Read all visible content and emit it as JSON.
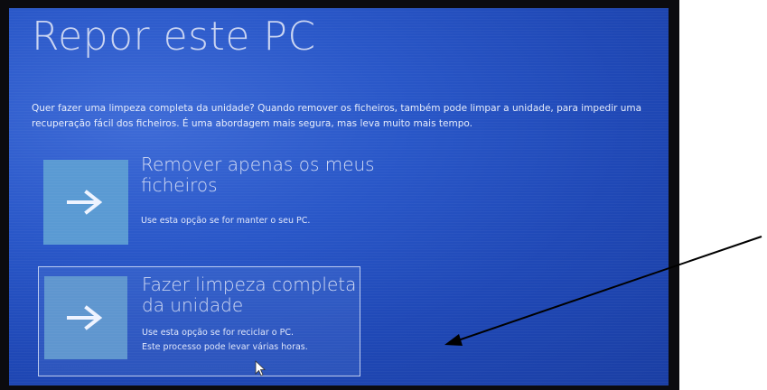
{
  "screen": {
    "title": "Repor este PC",
    "description": "Quer fazer uma limpeza completa da unidade? Quando remover os ficheiros, também pode limpar a unidade, para impedir uma recuperação fácil dos ficheiros. É uma abordagem mais segura, mas leva muito mais tempo.",
    "options": [
      {
        "title": "Remover apenas os meus ficheiros",
        "description_lines": [
          "Use esta opção se for manter o seu PC."
        ],
        "icon": "right-arrow-icon",
        "selected": false
      },
      {
        "title": "Fazer limpeza completa da unidade",
        "description_lines": [
          "Use esta opção se for reciclar o PC.",
          "Este processo pode levar várias horas."
        ],
        "icon": "right-arrow-icon",
        "selected": true
      }
    ]
  },
  "colors": {
    "screen_blue": "#2957c8",
    "tile_blue": "#5a9ad3",
    "bezel": "#0b0b0f",
    "annotation_arrow": "#000000"
  }
}
